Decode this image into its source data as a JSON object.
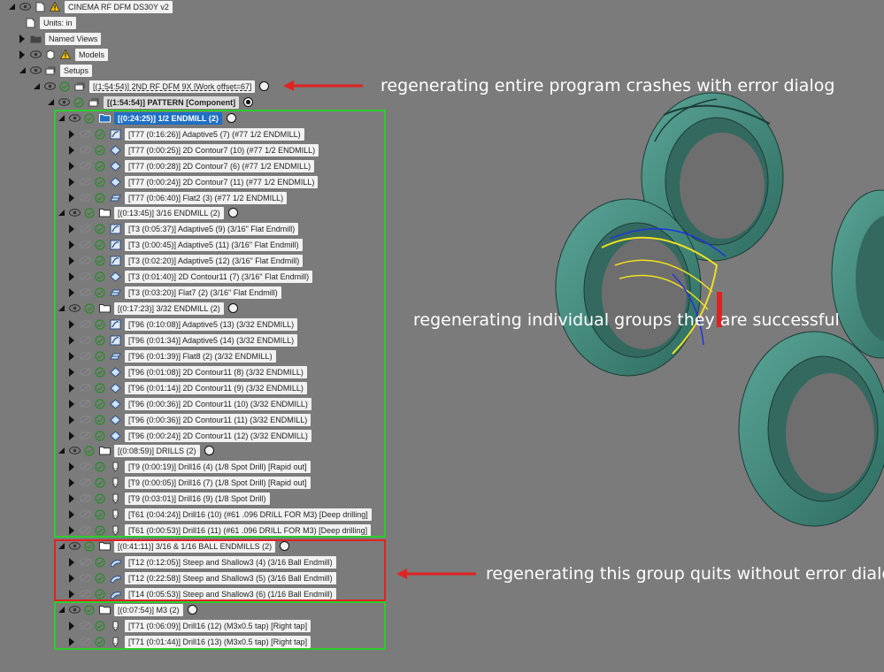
{
  "tree": {
    "root": "CINEMA RF DFM DS30Y v2",
    "units": "Units: in",
    "named_views": "Named Views",
    "models": "Models",
    "setups": "Setups",
    "setup": "[(1:54:54)] 2ND RF DFM 9X [Work offset=67]",
    "pattern": "[(1:54:54)] PATTERN [Component]",
    "groups": [
      {
        "label": "[(0:24:25)] 1/2 ENDMILL (2)",
        "selected": true,
        "ops": [
          {
            "label": "[T77 (0:16:26)] Adaptive5 (7) (#77 1/2 ENDMILL)",
            "icon": "adaptive-icon"
          },
          {
            "label": "[T77 (0:00:25)] 2D Contour7 (10) (#77 1/2 ENDMILL)",
            "icon": "contour-icon"
          },
          {
            "label": "[T77 (0:00:28)] 2D Contour7 (6) (#77 1/2 ENDMILL)",
            "icon": "contour-icon"
          },
          {
            "label": "[T77 (0:00:24)] 2D Contour7 (11) (#77 1/2 ENDMILL)",
            "icon": "contour-icon"
          },
          {
            "label": "[T77 (0:06:40)] Flat2 (3) (#77 1/2 ENDMILL)",
            "icon": "flat-icon"
          }
        ]
      },
      {
        "label": "[(0:13:45)] 3/16 ENDMILL (2)",
        "selected": false,
        "ops": [
          {
            "label": "[T3 (0:05:37)] Adaptive5 (9) (3/16\" Flat Endmill)",
            "icon": "adaptive-icon"
          },
          {
            "label": "[T3 (0:00:45)] Adaptive5 (11) (3/16\" Flat Endmill)",
            "icon": "adaptive-icon"
          },
          {
            "label": "[T3 (0:02:20)] Adaptive5 (12) (3/16\" Flat Endmill)",
            "icon": "adaptive-icon"
          },
          {
            "label": "[T3 (0:01:40)] 2D Contour11 (7) (3/16\" Flat Endmill)",
            "icon": "contour-icon"
          },
          {
            "label": "[T3 (0:03:20)] Flat7 (2) (3/16\" Flat Endmill)",
            "icon": "flat-icon"
          }
        ]
      },
      {
        "label": "[(0:17:23)] 3/32 ENDMILL (2)",
        "selected": false,
        "ops": [
          {
            "label": "[T96 (0:10:08)] Adaptive5 (13) (3/32 ENDMILL)",
            "icon": "adaptive-icon"
          },
          {
            "label": "[T96 (0:01:34)] Adaptive5 (14) (3/32 ENDMILL)",
            "icon": "adaptive-icon"
          },
          {
            "label": "[T96 (0:01:39)] Flat8 (2) (3/32 ENDMILL)",
            "icon": "flat-icon"
          },
          {
            "label": "[T96 (0:01:08)] 2D Contour11 (8) (3/32 ENDMILL)",
            "icon": "contour-icon"
          },
          {
            "label": "[T96 (0:01:14)] 2D Contour11 (9) (3/32 ENDMILL)",
            "icon": "contour-icon"
          },
          {
            "label": "[T96 (0:00:36)] 2D Contour11 (10) (3/32 ENDMILL)",
            "icon": "contour-icon"
          },
          {
            "label": "[T96 (0:00:36)] 2D Contour11 (11) (3/32 ENDMILL)",
            "icon": "contour-icon"
          },
          {
            "label": "[T96 (0:00:24)] 2D Contour11 (12) (3/32 ENDMILL)",
            "icon": "contour-icon"
          }
        ]
      },
      {
        "label": "[(0:08:59)] DRILLS (2)",
        "selected": false,
        "ops": [
          {
            "label": "[T9 (0:00:19)] Drill16 (4) (1/8 Spot Drill) [Rapid out]",
            "icon": "drill-icon"
          },
          {
            "label": "[T9 (0:00:05)] Drill16 (7) (1/8 Spot Drill) [Rapid out]",
            "icon": "drill-icon"
          },
          {
            "label": "[T9 (0:03:01)] Drill16 (9) (1/8 Spot Drill)",
            "icon": "drill-icon"
          },
          {
            "label": "[T61 (0:04:24)] Drill16 (10) (#61 .096 DRILL FOR M3) [Deep drilling]",
            "icon": "drill-icon"
          },
          {
            "label": "[T61 (0:00:53)] Drill16 (11) (#61 .096 DRILL FOR M3) [Deep drilling]",
            "icon": "drill-icon"
          }
        ]
      },
      {
        "label": "[(0:41:11)] 3/16 & 1/16 BALL ENDMILLS (2)",
        "selected": false,
        "ops": [
          {
            "label": "[T12 (0:12:05)] Steep and Shallow3 (4) (3/16 Ball Endmill)",
            "icon": "steep-shallow-icon"
          },
          {
            "label": "[T12 (0:22:58)] Steep and Shallow3 (5) (3/16 Ball Endmill)",
            "icon": "steep-shallow-icon"
          },
          {
            "label": "[T14 (0:05:53)] Steep and Shallow3 (6) (1/16 Ball Endmill)",
            "icon": "steep-shallow-icon"
          }
        ]
      },
      {
        "label": "[(0:07:54)] M3 (2)",
        "selected": false,
        "ops": [
          {
            "label": "[T71 (0:06:09)] Drill16 (12) (M3x0.5 tap) [Right tap]",
            "icon": "drill-icon"
          },
          {
            "label": "[T71 (0:01:44)] Drill16 (13) (M3x0.5 tap) [Right tap]",
            "icon": "drill-icon"
          }
        ]
      }
    ]
  },
  "annotations": {
    "program": "regenerating entire program crashes with error dialog",
    "groups": "regenerating individual groups they are successful",
    "ball_group": "regenerating this group quits without error dialog"
  },
  "colors": {
    "background": "#7b7b7b",
    "selection": "#1f6fc4",
    "green_box": "#2ecc2e",
    "red_box": "#e02222",
    "part": "#3f8a7c"
  }
}
